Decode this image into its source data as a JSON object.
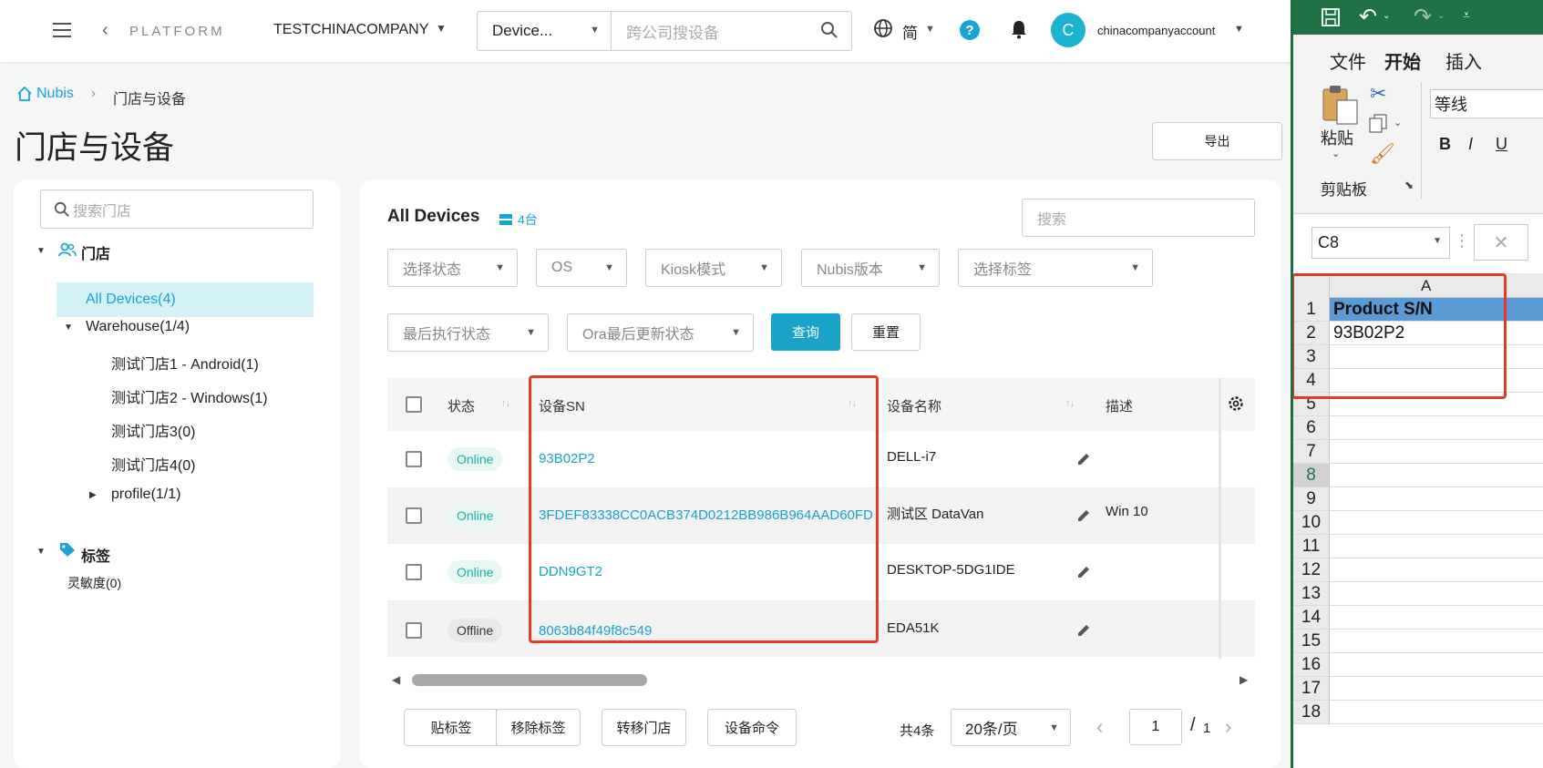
{
  "topbar": {
    "platform": "PLATFORM",
    "company": "TESTCHINACOMPANY",
    "search_scope": "Device...",
    "search_placeholder": "跨公司搜设备",
    "language": "简",
    "account": "chinacompanyaccount",
    "avatar_letter": "C"
  },
  "breadcrumb": {
    "home": "Nubis",
    "current": "门店与设备"
  },
  "page": {
    "title": "门店与设备",
    "export_label": "导出"
  },
  "sidebar": {
    "search_placeholder": "搜索门店",
    "stores_label": "门店",
    "all_devices": "All Devices(4)",
    "warehouse": "Warehouse(1/4)",
    "stores": [
      "测试门店1 - Android(1)",
      "测试门店2 - Windows(1)",
      "测试门店3(0)",
      "测试门店4(0)"
    ],
    "profile": "profile(1/1)",
    "tags_label": "标签",
    "tags": [
      "灵敏度(0)"
    ]
  },
  "main": {
    "title": "All Devices",
    "count": "4台",
    "search_placeholder": "搜索",
    "filters": [
      "选择状态",
      "OS",
      "Kiosk模式",
      "Nubis版本",
      "选择标签"
    ],
    "filters2": [
      "最后执行状态",
      "Ora最后更新状态"
    ],
    "query_label": "查询",
    "reset_label": "重置"
  },
  "table": {
    "headers": {
      "status": "状态",
      "sn": "设备SN",
      "name": "设备名称",
      "desc": "描述"
    },
    "rows": [
      {
        "status": "Online",
        "sn": "93B02P2",
        "name": "DELL-i7",
        "desc": ""
      },
      {
        "status": "Online",
        "sn": "3FDEF83338CC0ACB374D0212BB986B964AAD60FD",
        "name": "测试区 DataVan",
        "desc": "Win 10"
      },
      {
        "status": "Online",
        "sn": "DDN9GT2",
        "name": "DESKTOP-5DG1IDE",
        "desc": ""
      },
      {
        "status": "Offline",
        "sn": "8063b84f49f8c549",
        "name": "EDA51K",
        "desc": ""
      }
    ]
  },
  "footer": {
    "actions": [
      "贴标签",
      "移除标签",
      "转移门店",
      "设备命令"
    ],
    "total": "共4条",
    "page_size": "20条/页",
    "page": "1",
    "page_total": "1"
  },
  "excel": {
    "tabs": [
      "文件",
      "开始",
      "插入"
    ],
    "paste_label": "粘贴",
    "clipboard_label": "剪贴板",
    "font_name": "等线",
    "name_box": "C8",
    "column": "A",
    "rows": [
      "1",
      "2",
      "3",
      "4",
      "5",
      "6",
      "7",
      "8",
      "9",
      "10",
      "11",
      "12",
      "13",
      "14",
      "15",
      "16",
      "17",
      "18"
    ],
    "cells": [
      "Product S/N",
      "93B02P2"
    ]
  },
  "colors": {
    "accent": "#1aa3c9",
    "online": "#19b3a3",
    "highlight": "#e23c28",
    "excel_green": "#1f7244"
  }
}
